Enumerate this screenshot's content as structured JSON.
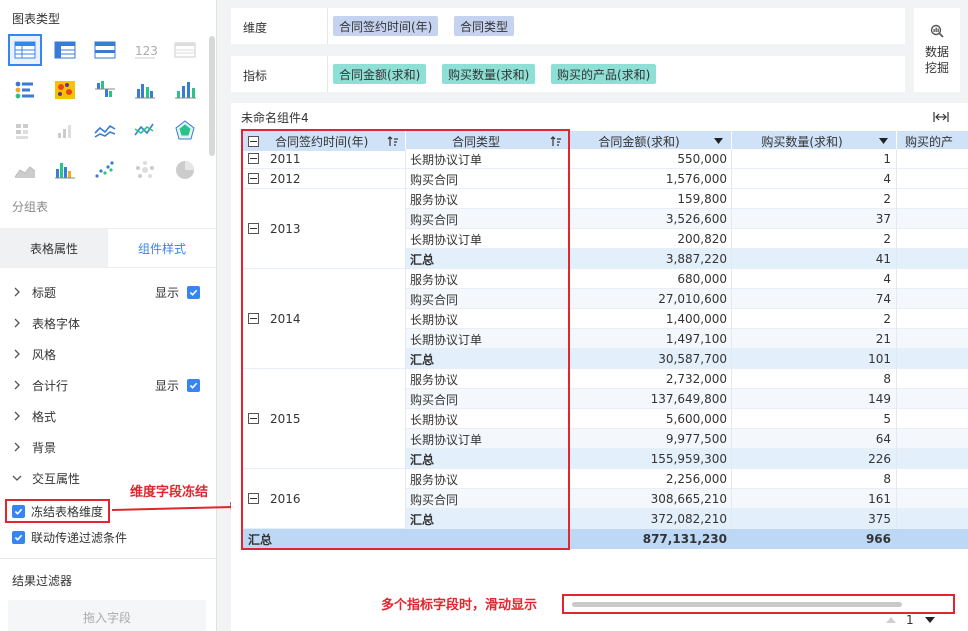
{
  "left_panel": {
    "chart_type_title": "图表类型",
    "group_table_label": "分组表",
    "tabs": [
      {
        "label": "表格属性",
        "active": false
      },
      {
        "label": "组件样式",
        "active": true
      }
    ],
    "properties": [
      {
        "label": "标题",
        "right": "显示",
        "checked": true,
        "expanded": false
      },
      {
        "label": "表格字体",
        "right": "",
        "expanded": false
      },
      {
        "label": "风格",
        "right": "",
        "expanded": false
      },
      {
        "label": "合计行",
        "right": "显示",
        "checked": true,
        "expanded": false
      },
      {
        "label": "格式",
        "right": "",
        "expanded": false
      },
      {
        "label": "背景",
        "right": "",
        "expanded": false
      },
      {
        "label": "交互属性",
        "right": "",
        "expanded": true
      }
    ],
    "checkboxes": [
      {
        "label": "冻结表格维度",
        "checked": true
      },
      {
        "label": "联动传递过滤条件",
        "checked": true
      }
    ],
    "result_filter_title": "结果过滤器",
    "drop_placeholder": "拖入字段",
    "chart_icons": [
      "table-icon",
      "cross-table-icon",
      "detail-table-icon",
      "kpi-number-icon",
      "disabled-table-icon",
      "dot-matrix-icon",
      "heatmap-icon",
      "grouped-bar-icon",
      "bar-icon",
      "column-icon",
      "disabled-grid-icon",
      "disabled-bar-icon",
      "line-icon",
      "line-scatter-icon",
      "radar-icon",
      "area-icon",
      "stacked-column-icon",
      "scatter-icon",
      "bubble-icon",
      "pie-icon"
    ]
  },
  "annotations": {
    "freeze_note": "维度字段冻结",
    "scroll_note": "多个指标字段时，滑动显示"
  },
  "config": {
    "dimension_label": "维度",
    "dimensions": [
      "合同签约时间(年)",
      "合同类型"
    ],
    "metric_label": "指标",
    "metrics": [
      "合同金额(求和)",
      "购买数量(求和)",
      "购买的产品(求和)"
    ],
    "mining_label_1": "数据",
    "mining_label_2": "挖掘"
  },
  "table": {
    "component_title": "未命名组件4",
    "headers": {
      "year": "合同签约时间(年)",
      "type": "合同类型",
      "amount": "合同金额(求和)",
      "qty": "购买数量(求和)",
      "product": "购买的产"
    },
    "groups": [
      {
        "year": "2011",
        "rows": [
          {
            "type": "长期协议订单",
            "amount": "550,000",
            "qty": "1"
          }
        ]
      },
      {
        "year": "2012",
        "rows": [
          {
            "type": "购买合同",
            "amount": "1,576,000",
            "qty": "4"
          }
        ]
      },
      {
        "year": "2013",
        "rows": [
          {
            "type": "服务协议",
            "amount": "159,800",
            "qty": "2"
          },
          {
            "type": "购买合同",
            "amount": "3,526,600",
            "qty": "37"
          },
          {
            "type": "长期协议订单",
            "amount": "200,820",
            "qty": "2"
          },
          {
            "type": "汇总",
            "amount": "3,887,220",
            "qty": "41",
            "subtotal": true
          }
        ]
      },
      {
        "year": "2014",
        "rows": [
          {
            "type": "服务协议",
            "amount": "680,000",
            "qty": "4"
          },
          {
            "type": "购买合同",
            "amount": "27,010,600",
            "qty": "74"
          },
          {
            "type": "长期协议",
            "amount": "1,400,000",
            "qty": "2"
          },
          {
            "type": "长期协议订单",
            "amount": "1,497,100",
            "qty": "21"
          },
          {
            "type": "汇总",
            "amount": "30,587,700",
            "qty": "101",
            "subtotal": true
          }
        ]
      },
      {
        "year": "2015",
        "rows": [
          {
            "type": "服务协议",
            "amount": "2,732,000",
            "qty": "8"
          },
          {
            "type": "购买合同",
            "amount": "137,649,800",
            "qty": "149"
          },
          {
            "type": "长期协议",
            "amount": "5,600,000",
            "qty": "5"
          },
          {
            "type": "长期协议订单",
            "amount": "9,977,500",
            "qty": "64"
          },
          {
            "type": "汇总",
            "amount": "155,959,300",
            "qty": "226",
            "subtotal": true
          }
        ]
      },
      {
        "year": "2016",
        "rows": [
          {
            "type": "服务协议",
            "amount": "2,256,000",
            "qty": "8"
          },
          {
            "type": "购买合同",
            "amount": "308,665,210",
            "qty": "161"
          },
          {
            "type": "汇总",
            "amount": "372,082,210",
            "qty": "375",
            "subtotal": true
          }
        ]
      }
    ],
    "grand_total": {
      "label": "汇总",
      "amount": "877,131,230",
      "qty": "966"
    },
    "pager_value": "1"
  },
  "colors": {
    "accent": "#3685f2",
    "annotation_red": "#e0262e",
    "header_bg": "#cfe2f7",
    "subtotal_bg": "#e3effb",
    "total_bg": "#bcd8f5",
    "dimension_pill": "#c5d3f0",
    "metric_pill": "#8ee0d6"
  }
}
